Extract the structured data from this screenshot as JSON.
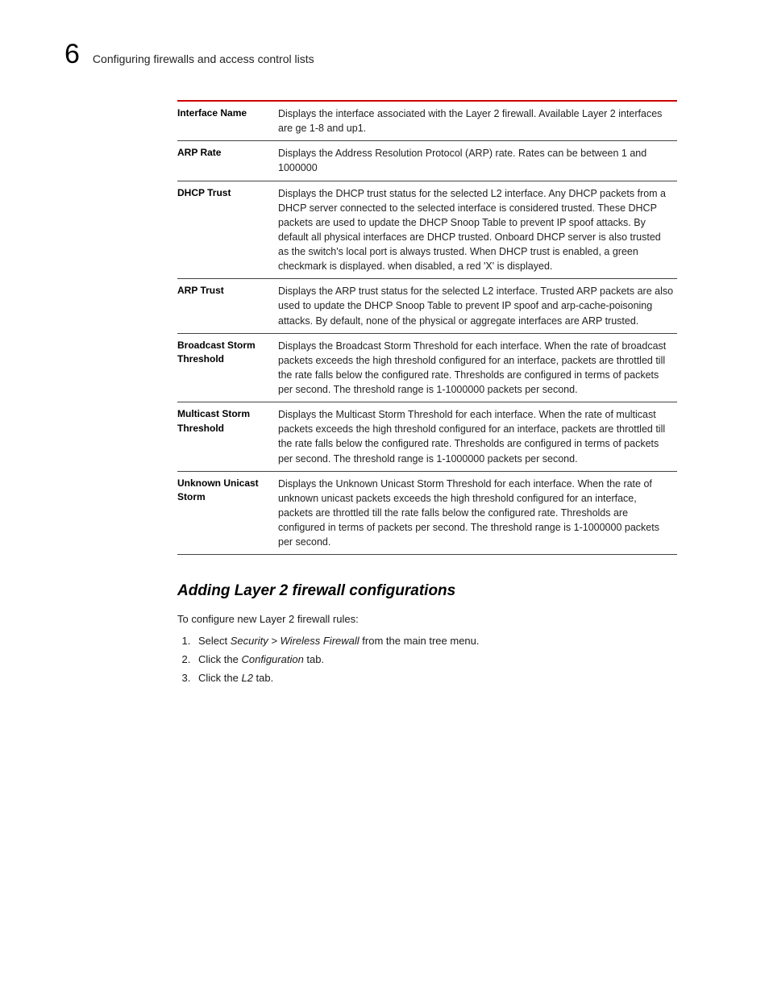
{
  "header": {
    "chapter_number": "6",
    "chapter_title": "Configuring firewalls and access control lists"
  },
  "table_rows": [
    {
      "term": "Interface Name",
      "desc": "Displays the interface associated with the Layer 2 firewall. Available Layer 2 interfaces are ge 1-8 and up1."
    },
    {
      "term": "ARP Rate",
      "desc": "Displays the Address Resolution Protocol (ARP) rate. Rates can be between 1 and 1000000"
    },
    {
      "term": "DHCP Trust",
      "desc": "Displays the DHCP trust status for the selected L2 interface.  Any DHCP packets from a DHCP server connected to the selected interface is considered trusted. These DHCP packets are used to update the DHCP Snoop Table to prevent IP spoof attacks. By default all physical interfaces are DHCP trusted. Onboard DHCP server is also trusted as the switch's local port is always trusted. When DHCP trust is enabled, a green checkmark is displayed. when disabled, a red 'X' is displayed."
    },
    {
      "term": "ARP Trust",
      "desc": "Displays the ARP trust status for the selected L2 interface. Trusted ARP packets are also used to update the DHCP Snoop Table to prevent IP spoof and arp-cache-poisoning attacks. By default, none of the physical or aggregate interfaces are ARP trusted."
    },
    {
      "term": "Broadcast Storm Threshold",
      "desc": "Displays the Broadcast Storm Threshold for each interface. When the rate of broadcast packets exceeds the high threshold configured for an interface, packets are throttled till the rate falls below the configured rate. Thresholds are configured in terms of packets per second. The threshold range is 1-1000000 packets per second."
    },
    {
      "term": "Multicast Storm Threshold",
      "desc": "Displays the Multicast Storm Threshold for each interface. When the rate of multicast packets exceeds the high threshold configured for an interface, packets are throttled till the rate falls below the configured rate. Thresholds are configured in terms of packets per second. The threshold range is 1-1000000 packets per second."
    },
    {
      "term": "Unknown Unicast Storm",
      "desc": "Displays the Unknown Unicast Storm Threshold for each interface. When the rate of unknown unicast packets exceeds the high threshold configured for an interface, packets are throttled till the rate falls below the configured rate. Thresholds are configured in terms of packets per second. The threshold range is 1-1000000 packets per second."
    }
  ],
  "subsection_heading": "Adding Layer 2 firewall configurations",
  "subsection_intro": "To configure new Layer 2 firewall rules:",
  "steps": [
    {
      "pre": "Select ",
      "it": "Security > Wireless Firewall",
      "post": " from the main tree menu."
    },
    {
      "pre": "Click the ",
      "it": "Configuration",
      "post": " tab."
    },
    {
      "pre": "Click the ",
      "it": "L2",
      "post": " tab."
    }
  ]
}
